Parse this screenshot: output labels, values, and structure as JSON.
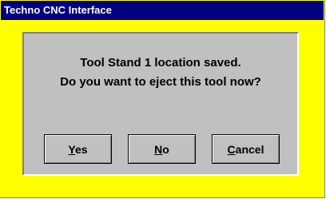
{
  "window": {
    "title": "Techno CNC Interface"
  },
  "dialog": {
    "message_line1": "Tool Stand 1 location saved.",
    "message_line2": "Do you want to eject this tool now?"
  },
  "buttons": {
    "yes": {
      "mnemonic": "Y",
      "rest": "es"
    },
    "no": {
      "mnemonic": "N",
      "rest": "o"
    },
    "cancel": {
      "mnemonic": "C",
      "rest": "ancel"
    }
  },
  "colors": {
    "title_bar": "#000080",
    "frame": "#ffff00",
    "panel": "#c0c0c0"
  }
}
